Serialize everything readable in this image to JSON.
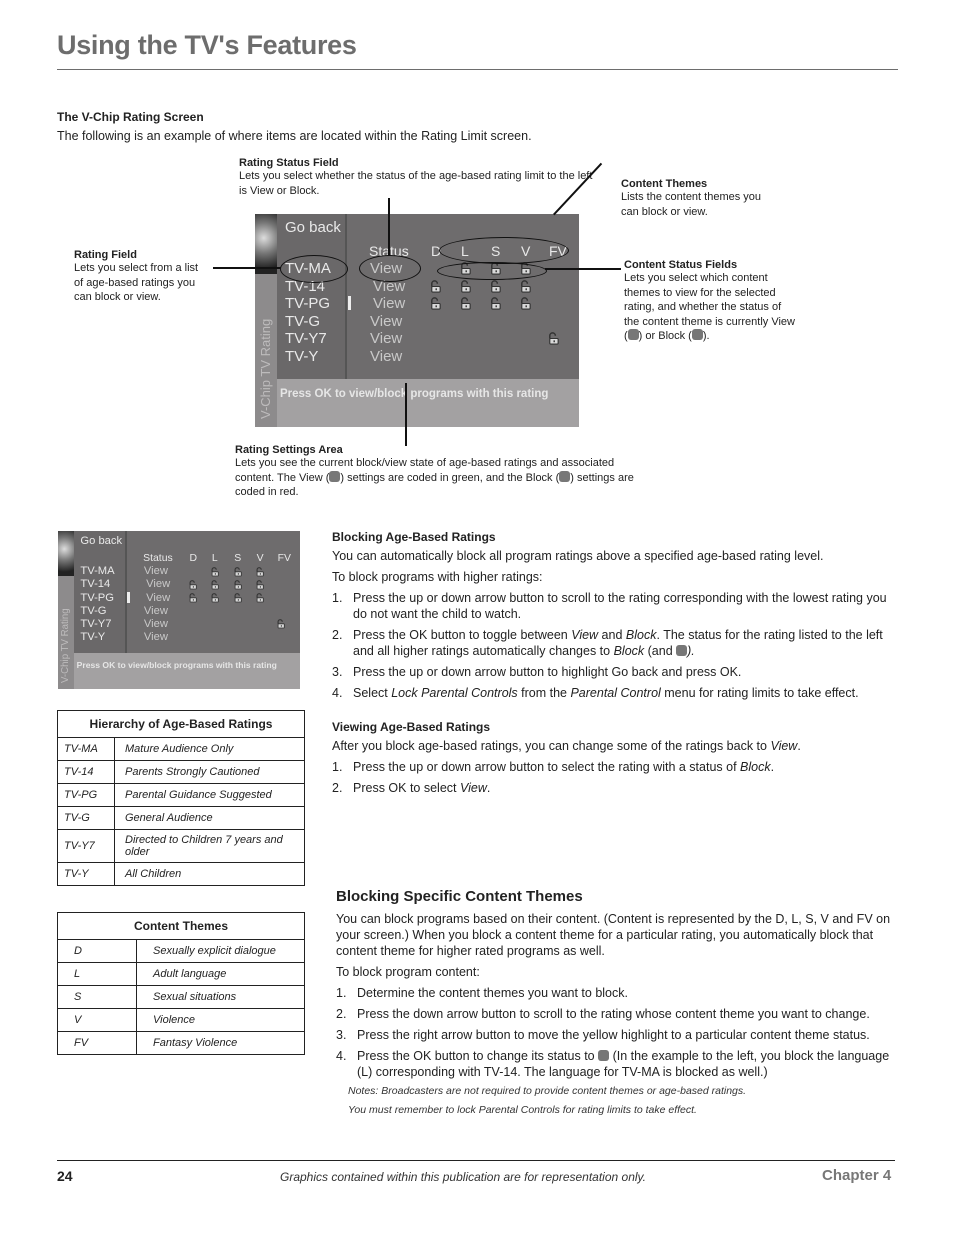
{
  "header": {
    "title": "Using the TV's Features"
  },
  "intro": {
    "heading": "The V-Chip Rating Screen",
    "text": "The following is an example of where items are located within the Rating Limit screen."
  },
  "callouts": {
    "rating_status": {
      "title": "Rating Status Field",
      "text": "Lets you select whether the status of the age-based rating limit to the left is View or Block."
    },
    "content_themes": {
      "title": "Content Themes",
      "text": "Lists the content themes you can block or view."
    },
    "rating_field": {
      "title": "Rating Field",
      "text": "Lets you select from a list of age-based ratings you can block or view."
    },
    "content_status": {
      "title": "Content Status Fields",
      "text_a": "Lets you select which content themes to view for the selected rating, and whether the status of the content theme is currently View (",
      "text_b": ") or Block (",
      "text_c": ")."
    },
    "rating_settings": {
      "title": "Rating Settings Area",
      "text_a": "Lets you see the current block/view state of age-based ratings and associated content. The View (",
      "text_b": ") settings are coded in green, and the Block (",
      "text_c": ") settings are coded in red."
    }
  },
  "tv_screen": {
    "side_label": "V-Chip TV Rating",
    "go_back": "Go back",
    "status_header": "Status",
    "themes": [
      "D",
      "L",
      "S",
      "V",
      "FV"
    ],
    "ratings": [
      {
        "rating": "TV-MA",
        "status": "View",
        "locks": [
          false,
          true,
          true,
          true,
          false
        ]
      },
      {
        "rating": "TV-14",
        "status": "View",
        "locks": [
          true,
          true,
          true,
          true,
          false
        ]
      },
      {
        "rating": "TV-PG",
        "status": "View",
        "locks": [
          true,
          true,
          true,
          true,
          false
        ]
      },
      {
        "rating": "TV-G",
        "status": "View",
        "locks": [
          false,
          false,
          false,
          false,
          false
        ]
      },
      {
        "rating": "TV-Y7",
        "status": "View",
        "locks": [
          false,
          false,
          false,
          false,
          true
        ]
      },
      {
        "rating": "TV-Y",
        "status": "View",
        "locks": [
          false,
          false,
          false,
          false,
          false
        ]
      }
    ],
    "hint": "Press OK to view/block programs with this rating"
  },
  "blocking_age": {
    "heading": "Blocking Age-Based Ratings",
    "p1": "You can automatically block all program ratings above a specified age-based rating level.",
    "p2": "To block programs with higher ratings:",
    "steps": [
      {
        "n": "1.",
        "text": "Press the up or down arrow button to scroll to the rating corresponding with the lowest rating you do not want the child to watch."
      },
      {
        "n": "2.",
        "a": "Press the OK button to toggle between ",
        "i1": "View",
        "b": " and ",
        "i2": "Block",
        "c": ". The status for the rating listed to the left and all higher ratings automatically changes to ",
        "i3": "Block",
        "d": " (and ",
        "e": ")."
      },
      {
        "n": "3.",
        "text": "Press the up or down arrow button to highlight Go back and press OK."
      },
      {
        "n": "4.",
        "a": "Select ",
        "i1": "Lock Parental Controls",
        "b": " from the ",
        "i2": "Parental Control",
        "c": " menu for rating limits to take effect."
      }
    ]
  },
  "viewing_age": {
    "heading": "Viewing Age-Based Ratings",
    "p1_a": "After you block age-based ratings, you can change some of the ratings back to ",
    "p1_i": "View",
    "p1_b": ".",
    "steps": [
      {
        "n": "1.",
        "a": "Press the up or down arrow button to select the rating with a status of ",
        "i": "Block",
        "b": "."
      },
      {
        "n": "2.",
        "a": "Press OK to select ",
        "i": "View",
        "b": "."
      }
    ]
  },
  "hierarchy_table": {
    "title": "Hierarchy of Age-Based Ratings",
    "rows": [
      [
        "TV-MA",
        "Mature Audience Only"
      ],
      [
        "TV-14",
        "Parents Strongly Cautioned"
      ],
      [
        "TV-PG",
        "Parental Guidance Suggested"
      ],
      [
        "TV-G",
        "General Audience"
      ],
      [
        "TV-Y7",
        "Directed to Children 7 years and older"
      ],
      [
        "TV-Y",
        "All Children"
      ]
    ]
  },
  "themes_table": {
    "title": "Content Themes",
    "rows": [
      [
        "D",
        "Sexually explicit dialogue"
      ],
      [
        "L",
        "Adult language"
      ],
      [
        "S",
        "Sexual situations"
      ],
      [
        "V",
        "Violence"
      ],
      [
        "FV",
        "Fantasy Violence"
      ]
    ]
  },
  "blocking_themes": {
    "heading": "Blocking Specific Content Themes",
    "p1": "You can block programs based on their content. (Content is represented by the D, L, S, V and FV on your screen.) When you block a content theme for a particular rating, you automatically block that content theme for higher rated programs as well.",
    "p2": "To block program content:",
    "steps": [
      {
        "n": "1.",
        "text": "Determine the content themes you want to block."
      },
      {
        "n": "2.",
        "text": "Press the down arrow button to scroll to the rating whose content theme you want to change."
      },
      {
        "n": "3.",
        "text": "Press the right arrow button to move the yellow highlight to a particular content theme status."
      },
      {
        "n": "4.",
        "a": "Press the OK button to change its status to ",
        "b": " (In the example to the left, you block the language (L) corresponding with TV-14. The language for TV-MA is blocked as well.)"
      }
    ],
    "note1": "Notes: Broadcasters are not required to provide content themes or age-based ratings.",
    "note2": "You must remember to lock Parental Controls for rating limits to take effect."
  },
  "footer": {
    "page_number": "24",
    "disclaimer": "Graphics contained within this publication are for representation only.",
    "chapter": "Chapter 4"
  }
}
